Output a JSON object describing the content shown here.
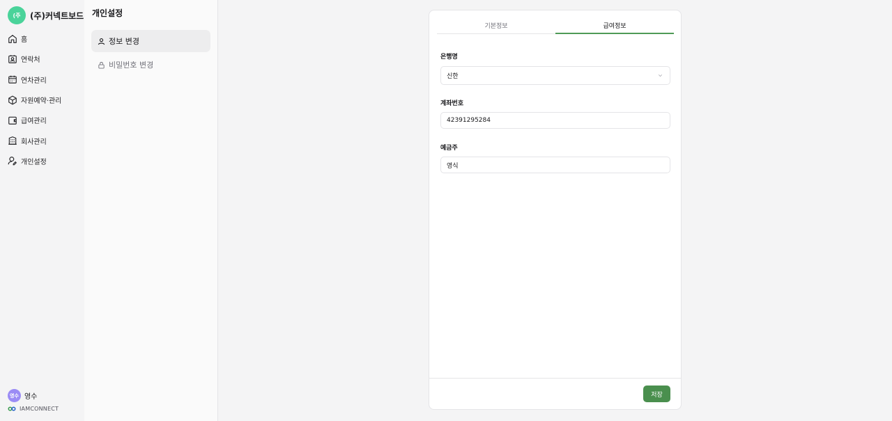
{
  "brand": {
    "logo_text": "(주",
    "name": "(주)커넥트보드"
  },
  "nav": {
    "items": [
      {
        "label": "홈",
        "icon": "home-icon"
      },
      {
        "label": "연락처",
        "icon": "contact-icon"
      },
      {
        "label": "연차관리",
        "icon": "calendar-icon"
      },
      {
        "label": "자원예약·관리",
        "icon": "box-icon"
      },
      {
        "label": "급여관리",
        "icon": "wallet-icon"
      },
      {
        "label": "회사관리",
        "icon": "building-icon"
      },
      {
        "label": "개인설정",
        "icon": "user-settings-icon"
      }
    ]
  },
  "profile": {
    "avatar_text": "영수",
    "name": "영수"
  },
  "company": {
    "name": "IAMCONNECT",
    "icon": "infinity-logo-icon"
  },
  "submenu": {
    "title": "개인설정",
    "items": [
      {
        "label": "정보 변경",
        "icon": "user-icon",
        "active": true
      },
      {
        "label": "비밀번호 변경",
        "icon": "lock-icon",
        "active": false
      }
    ]
  },
  "tabs": [
    {
      "label": "기본정보",
      "active": false
    },
    {
      "label": "급여정보",
      "active": true
    }
  ],
  "form": {
    "bank": {
      "label": "은행명",
      "value": "신한"
    },
    "account": {
      "label": "계좌번호",
      "value": "42391295284"
    },
    "holder": {
      "label": "예금주",
      "value": "영식"
    }
  },
  "footer": {
    "save_label": "저장"
  },
  "colors": {
    "accent": "#4a8f4e",
    "brand_logo": "#4ad39a",
    "avatar": "#9b8cf5"
  }
}
